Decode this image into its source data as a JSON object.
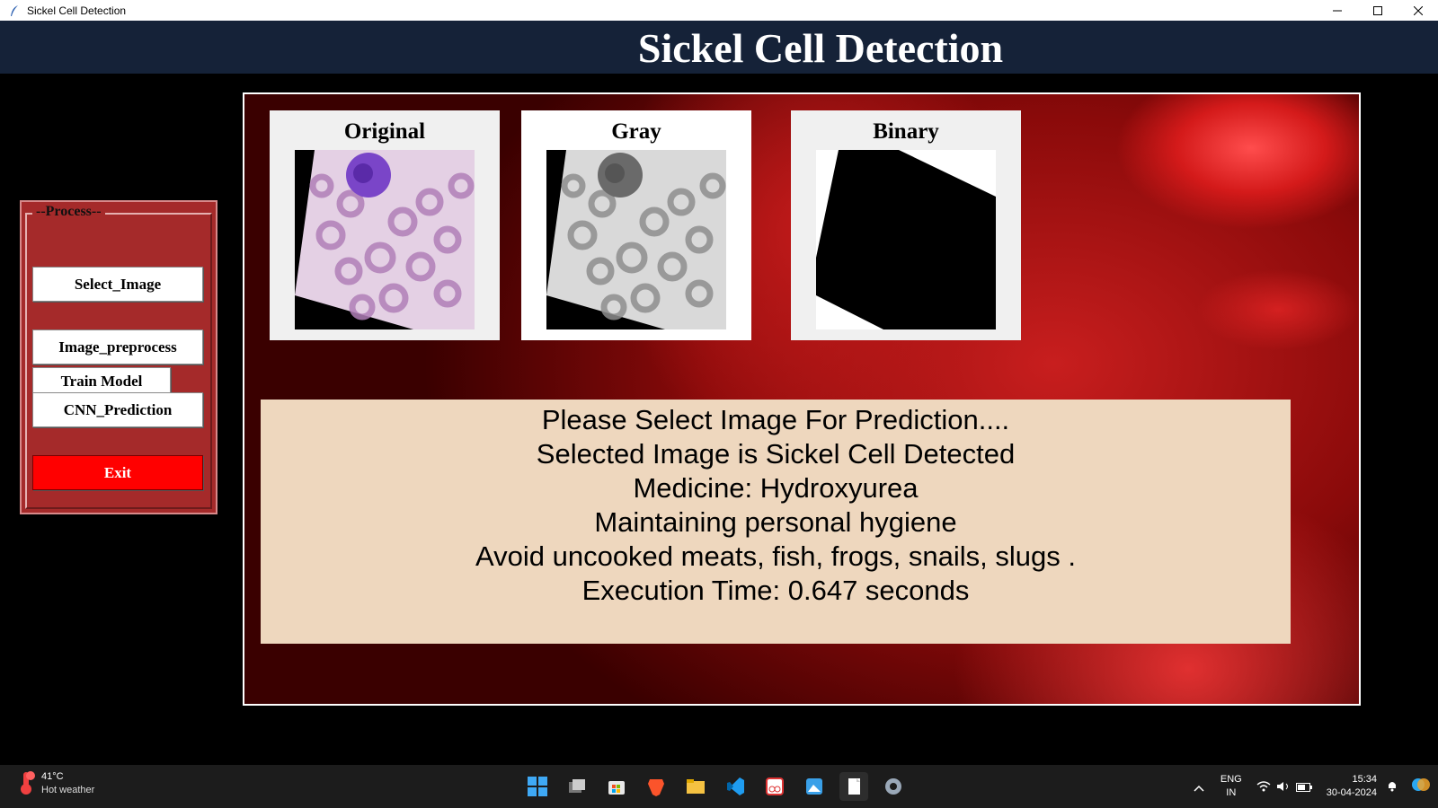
{
  "window": {
    "title": "Sickel Cell Detection"
  },
  "header": {
    "title": "Sickel Cell Detection"
  },
  "process": {
    "legend": "--Process--",
    "buttons": {
      "select_image": "Select_Image",
      "image_preprocess": "Image_preprocess",
      "train_model": "Train Model",
      "cnn_prediction": "CNN_Prediction",
      "exit": "Exit"
    }
  },
  "images": {
    "original": "Original",
    "gray": "Gray",
    "binary": "Binary"
  },
  "output": {
    "lines": [
      "Please Select Image For Prediction....",
      "Selected Image is Sickel Cell Detected",
      "Medicine: Hydroxyurea",
      "Maintaining personal hygiene",
      "Avoid uncooked meats, fish, frogs, snails, slugs .",
      "Execution Time: 0.647 seconds"
    ]
  },
  "taskbar": {
    "weather": {
      "temp": "41°C",
      "condition": "Hot weather"
    },
    "language": {
      "lang": "ENG",
      "region": "IN"
    },
    "clock": {
      "time": "15:34",
      "date": "30-04-2024"
    },
    "icons": [
      "windows-start",
      "task-view",
      "microsoft-store",
      "brave-browser",
      "file-explorer",
      "vs-code",
      "snipping-tool",
      "photos",
      "notepad",
      "settings"
    ]
  },
  "colors": {
    "header_bg": "#152238",
    "process_bg": "#a52a2a",
    "exit_button": "#ff0000",
    "info_bg": "#eed7be"
  }
}
